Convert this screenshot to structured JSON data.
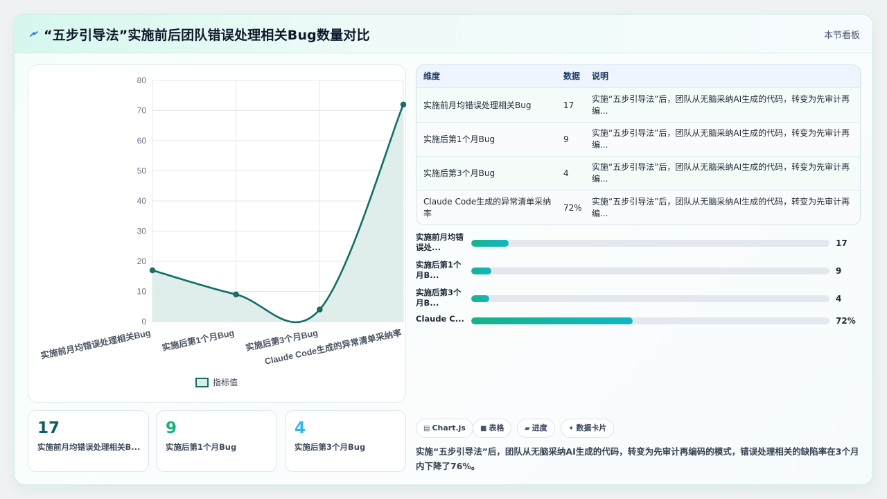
{
  "header": {
    "title": "“五步引导法”实施前后团队错误处理相关Bug数量对比",
    "right_label": "本节看板",
    "icon": "lightning-icon"
  },
  "chart_data": {
    "type": "line",
    "categories": [
      "实施前月均错误处理相关Bug",
      "实施后第1个月Bug",
      "实施后第3个月Bug",
      "Claude Code生成的异常清单采纳率"
    ],
    "series": [
      {
        "name": "指标值",
        "values": [
          17,
          9,
          4,
          72
        ]
      }
    ],
    "ylim": [
      0,
      80
    ],
    "yticks": [
      0,
      10,
      20,
      30,
      40,
      50,
      60,
      70,
      80
    ],
    "grid": true,
    "fill": true,
    "smooth": true,
    "legend_position": "bottom",
    "line_color": "#0f6e66",
    "fill_color": "#dcece9"
  },
  "table": {
    "headers": [
      "维度",
      "数据",
      "说明"
    ],
    "rows": [
      [
        "实施前月均错误处理相关Bug",
        "17",
        "实施“五步引导法”后，团队从无脑采纳AI生成的代码，转变为先审计再编..."
      ],
      [
        "实施后第1个月Bug",
        "9",
        "实施“五步引导法”后，团队从无脑采纳AI生成的代码，转变为先审计再编..."
      ],
      [
        "实施后第3个月Bug",
        "4",
        "实施“五步引导法”后，团队从无脑采纳AI生成的代码，转变为先审计再编..."
      ],
      [
        "Claude Code生成的异常清单采纳率",
        "72%",
        "实施“五步引导法”后，团队从无脑采纳AI生成的代码，转变为先审计再编..."
      ]
    ]
  },
  "progress": [
    {
      "label": "实施前月均错误处...",
      "value": 17,
      "display": "17",
      "fraction": 0.105
    },
    {
      "label": "实施后第1个月B...",
      "value": 9,
      "display": "9",
      "fraction": 0.056
    },
    {
      "label": "实施后第3个月B...",
      "value": 4,
      "display": "4",
      "fraction": 0.05
    },
    {
      "label": "Claude C...",
      "value": 72,
      "display": "72%",
      "fraction": 0.45
    }
  ],
  "stats": [
    {
      "value": "17",
      "label": "实施前月均错误处理相关B...",
      "color": "#0f5f57"
    },
    {
      "value": "9",
      "label": "实施后第1个月Bug",
      "color": "#19b07f"
    },
    {
      "value": "4",
      "label": "实施后第3个月Bug",
      "color": "#38b6e0"
    }
  ],
  "tags": [
    {
      "icon": "chart-icon",
      "label": "Chart.js"
    },
    {
      "icon": "table-icon",
      "label": "表格"
    },
    {
      "icon": "progress-icon",
      "label": "进度"
    },
    {
      "icon": "card-icon",
      "label": "数据卡片"
    }
  ],
  "summary": "实施“五步引导法”后，团队从无脑采纳AI生成的代码，转变为先审计再编码的模式，错误处理相关的缺陷率在3个月内下降了76%。"
}
